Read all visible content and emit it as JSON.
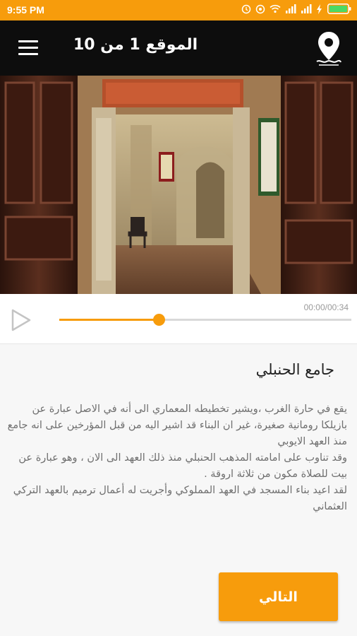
{
  "status_bar": {
    "time": "9:55 PM",
    "icons": [
      "alarm-icon",
      "wifi-icon",
      "signal-icon",
      "signal-icon",
      "charging-icon",
      "battery-icon"
    ],
    "background_color": "#f79c0c"
  },
  "app_bar": {
    "title": "الموقع 1 من 10",
    "menu_icon": "menu-icon",
    "location_icon": "location-pin-icon",
    "background_color": "#0d0d0d"
  },
  "audio_player": {
    "time": "00:00/00:34",
    "progress": 0.34,
    "play_icon": "play-icon",
    "accent_color": "#f79c0c"
  },
  "place": {
    "title": "جامع الحنبلي",
    "description": "يقع في حارة الغرب ،ويشير تخطيطه المعماري الى أنه في الاصل عبارة عن بازيلكا رومانية صغيرة، غير ان البناء قد اشير اليه من قبل المؤرخين على انه جامع منذ العهد الايوبي\nوقد تناوب على امامته المذهب الحنبلي منذ ذلك العهد الى الان ، وهو عبارة عن بيت للصلاة مكون من ثلاثة اروقة .\nلقد اعيد بناء المسجد في العهد المملوكي وأجريت له أعمال ترميم بالعهد التركي العثماني"
  },
  "next_button": {
    "label": "التالي"
  }
}
